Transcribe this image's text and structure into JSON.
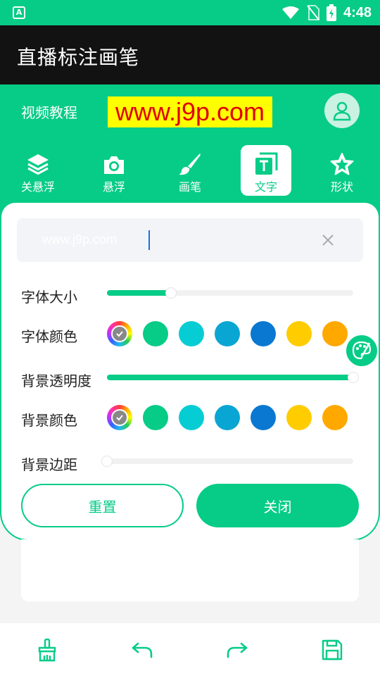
{
  "status_bar": {
    "time": "4:48",
    "app_badge": "A"
  },
  "title_bar": {
    "title": "直播标注画笔"
  },
  "header": {
    "tutorial_label": "视频教程",
    "watermark_text": "www.j9p.com"
  },
  "toolbar": {
    "active_index": 3,
    "items": [
      {
        "label": "关悬浮",
        "icon": "layers-icon"
      },
      {
        "label": "悬浮",
        "icon": "camera-icon"
      },
      {
        "label": "画笔",
        "icon": "brush-icon"
      },
      {
        "label": "文字",
        "icon": "text-icon"
      },
      {
        "label": "形状",
        "icon": "star-icon"
      }
    ]
  },
  "text_input": {
    "value": "www.j9p.com"
  },
  "settings": {
    "font_size": {
      "label": "字体大小",
      "value": 0.26
    },
    "font_color": {
      "label": "字体颜色"
    },
    "bg_opacity": {
      "label": "背景透明度",
      "value": 1.0
    },
    "bg_color": {
      "label": "背景颜色"
    },
    "bg_padding": {
      "label": "背景边距",
      "value": 0.0
    }
  },
  "palette": [
    "#06cc87",
    "#06cdd3",
    "#09a6d3",
    "#0a78d1",
    "#ffcc00",
    "#ffa800"
  ],
  "buttons": {
    "reset": "重置",
    "close": "关闭"
  },
  "bottom_bar": [
    "clean-brush-icon",
    "undo-icon",
    "redo-icon",
    "save-icon"
  ],
  "colors": {
    "accent": "#06cc87",
    "title_bg": "#121212",
    "watermark_bg": "#ffff00",
    "watermark_fg": "#e00000"
  }
}
